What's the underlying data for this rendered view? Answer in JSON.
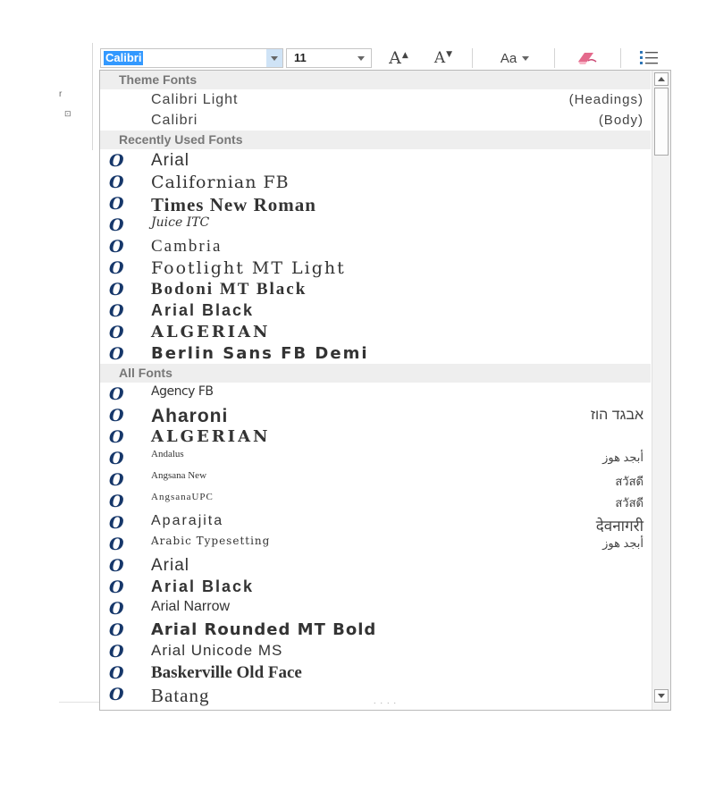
{
  "ribbon": {
    "font_name": "Calibri",
    "font_size": "11",
    "grow_label": "A",
    "shrink_label": "A",
    "case_label": "Aa",
    "icons": [
      "chevron-down-icon",
      "grow-font-icon",
      "shrink-font-icon",
      "change-case-icon",
      "clear-formatting-icon",
      "bullets-icon"
    ]
  },
  "colors": {
    "selection": "#3399ff",
    "font_icon": "#16376a",
    "section_header_bg": "#eeeeee"
  },
  "dropdown": {
    "theme_header": "Theme Fonts",
    "theme_fonts": [
      {
        "name": "Calibri Light",
        "tag": "(Headings)"
      },
      {
        "name": "Calibri",
        "tag": "(Body)"
      }
    ],
    "recent_header": "Recently Used Fonts",
    "recent_fonts": [
      {
        "name": "Arial"
      },
      {
        "name": "Californian FB"
      },
      {
        "name": "Times New Roman"
      },
      {
        "name": "Juice ITC"
      },
      {
        "name": "Cambria"
      },
      {
        "name": "Footlight MT Light"
      },
      {
        "name": "Bodoni MT Black"
      },
      {
        "name": "Arial Black"
      },
      {
        "name": "ALGERIAN"
      },
      {
        "name": "Berlin Sans FB Demi"
      }
    ],
    "all_header": "All Fonts",
    "all_fonts": [
      {
        "name": "Agency FB",
        "sample": ""
      },
      {
        "name": "Aharoni",
        "sample": "אבגד הוז"
      },
      {
        "name": "ALGERIAN",
        "sample": ""
      },
      {
        "name": "Andalus",
        "sample": "أبجد هوز"
      },
      {
        "name": "Angsana New",
        "sample": "สวัสดี"
      },
      {
        "name": "AngsanaUPC",
        "sample": "สวัสดี"
      },
      {
        "name": "Aparajita",
        "sample": "देवनागरी"
      },
      {
        "name": "Arabic Typesetting",
        "sample": "أبجد هوز"
      },
      {
        "name": "Arial",
        "sample": ""
      },
      {
        "name": "Arial Black",
        "sample": ""
      },
      {
        "name": "Arial Narrow",
        "sample": ""
      },
      {
        "name": "Arial Rounded MT Bold",
        "sample": ""
      },
      {
        "name": "Arial Unicode MS",
        "sample": ""
      },
      {
        "name": "Baskerville Old Face",
        "sample": ""
      },
      {
        "name": "Batang",
        "sample": ""
      }
    ],
    "font_type_glyph": "O"
  }
}
